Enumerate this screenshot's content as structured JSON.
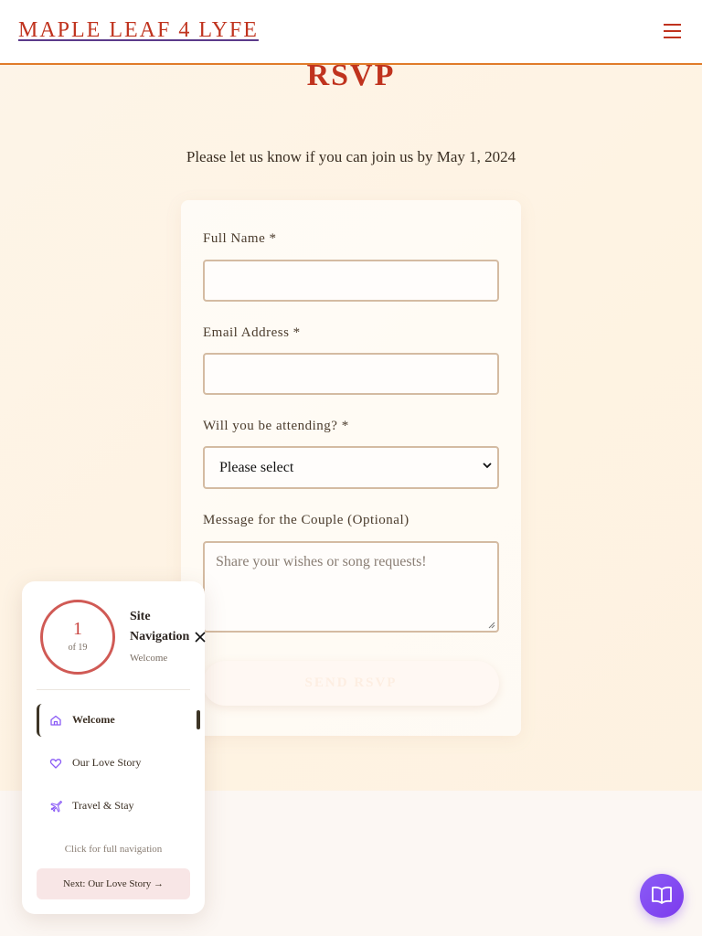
{
  "header": {
    "brand": "MAPLE LEAF 4 LYFE",
    "menu_icon": "hamburger-menu-icon"
  },
  "rsvp": {
    "title": "RSVP",
    "intro": "Please let us know if you can join us by May 1, 2024",
    "fields": {
      "full_name_label": "Full Name *",
      "email_label": "Email Address *",
      "attending_label": "Will you be attending? *",
      "attending_value": "Please select",
      "message_label": "Message for the Couple (Optional)",
      "message_placeholder": "Share your wishes or song requests!"
    },
    "submit_label": "SEND RSVP"
  },
  "nav_panel": {
    "progress_current": "1",
    "progress_total_text": "of 19",
    "title": "Site Navigation",
    "current_section": "Welcome",
    "items": [
      {
        "label": "Welcome",
        "icon": "home-icon",
        "active": true
      },
      {
        "label": "Our Love Story",
        "icon": "heart-icon",
        "active": false
      },
      {
        "label": "Travel & Stay",
        "icon": "plane-icon",
        "active": false
      }
    ],
    "hint": "Click for full navigation",
    "next_label": "Next: Our Love Story →"
  },
  "fab": {
    "icon": "book-open-icon"
  },
  "colors": {
    "accent": "#c0331e",
    "header_border": "#e07b2a",
    "nav_icon": "#8b5cf6",
    "fab": "#7c3aed"
  }
}
